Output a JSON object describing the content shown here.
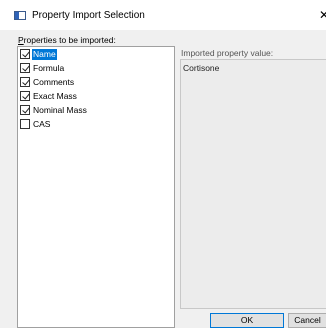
{
  "window": {
    "title": "Property Import Selection",
    "close_glyph": "✕"
  },
  "properties_panel": {
    "label_access_key": "P",
    "label_rest": "roperties to be imported:",
    "items": [
      {
        "label": "Name",
        "checked": true,
        "selected": true
      },
      {
        "label": "Formula",
        "checked": true,
        "selected": false
      },
      {
        "label": "Comments",
        "checked": true,
        "selected": false
      },
      {
        "label": "Exact Mass",
        "checked": true,
        "selected": false
      },
      {
        "label": "Nominal Mass",
        "checked": true,
        "selected": false
      },
      {
        "label": "CAS",
        "checked": false,
        "selected": false
      }
    ]
  },
  "value_panel": {
    "label": "Imported property value:",
    "value": "Cortisone"
  },
  "buttons": {
    "ok": "OK",
    "cancel": "Cancel"
  },
  "colors": {
    "selection": "#0078d7",
    "title_bar": "#ffffff",
    "dialog_bg": "#f0f0f0"
  }
}
